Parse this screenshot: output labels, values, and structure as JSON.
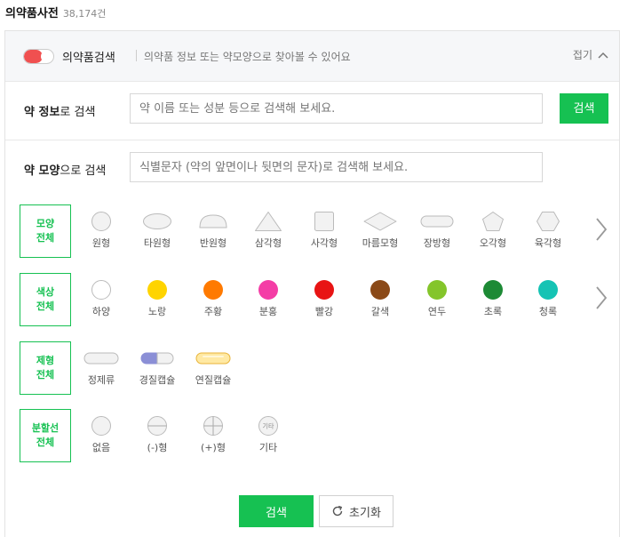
{
  "header": {
    "title": "의약품사전",
    "count": "38,174건"
  },
  "panel": {
    "title": "의약품검색",
    "description": "의약품 정보 또는 약모양으로 찾아볼 수 있어요",
    "collapse_label": "접기"
  },
  "search_by_info": {
    "label_bold": "약 정보",
    "label_rest": "로 검색",
    "placeholder": "약 이름 또는 성분 등으로 검색해 보세요.",
    "button": "검색"
  },
  "search_by_shape": {
    "label_bold": "약 모양",
    "label_rest": "으로 검색",
    "placeholder": "식별문자 (약의 앞면이나 뒷면의 문자)로 검색해 보세요."
  },
  "shape_filter": {
    "category_line1": "모양",
    "category_line2": "전체",
    "options": [
      {
        "label": "원형",
        "icon": "circle-shape-icon"
      },
      {
        "label": "타원형",
        "icon": "ellipse-shape-icon"
      },
      {
        "label": "반원형",
        "icon": "semicircle-shape-icon"
      },
      {
        "label": "삼각형",
        "icon": "triangle-shape-icon"
      },
      {
        "label": "사각형",
        "icon": "square-shape-icon"
      },
      {
        "label": "마름모형",
        "icon": "rhombus-shape-icon"
      },
      {
        "label": "장방형",
        "icon": "oblong-shape-icon"
      },
      {
        "label": "오각형",
        "icon": "pentagon-shape-icon"
      },
      {
        "label": "육각형",
        "icon": "hexagon-shape-icon"
      }
    ]
  },
  "color_filter": {
    "category_line1": "색상",
    "category_line2": "전체",
    "options": [
      {
        "label": "하양",
        "color": "#ffffff"
      },
      {
        "label": "노랑",
        "color": "#ffd400"
      },
      {
        "label": "주황",
        "color": "#ff7a00"
      },
      {
        "label": "분홍",
        "color": "#f43da6"
      },
      {
        "label": "빨강",
        "color": "#e81414"
      },
      {
        "label": "갈색",
        "color": "#8b4a18"
      },
      {
        "label": "연두",
        "color": "#84c52b"
      },
      {
        "label": "초록",
        "color": "#1d8a35"
      },
      {
        "label": "청록",
        "color": "#15c3b4"
      }
    ]
  },
  "form_filter": {
    "category_line1": "제형",
    "category_line2": "전체",
    "options": [
      {
        "label": "정제류",
        "icon": "tablet-icon"
      },
      {
        "label": "경질캡슐",
        "icon": "hard-capsule-icon"
      },
      {
        "label": "연질캡슐",
        "icon": "soft-capsule-icon"
      }
    ]
  },
  "line_filter": {
    "category_line1": "분할선",
    "category_line2": "전체",
    "options": [
      {
        "label": "없음",
        "icon": "no-line-icon"
      },
      {
        "label": "(-)형",
        "icon": "minus-line-icon"
      },
      {
        "label": "(+)형",
        "icon": "plus-line-icon"
      },
      {
        "label": "기타",
        "icon": "other-line-icon",
        "icon_text": "기타"
      }
    ]
  },
  "actions": {
    "search": "검색",
    "reset": "초기화"
  }
}
